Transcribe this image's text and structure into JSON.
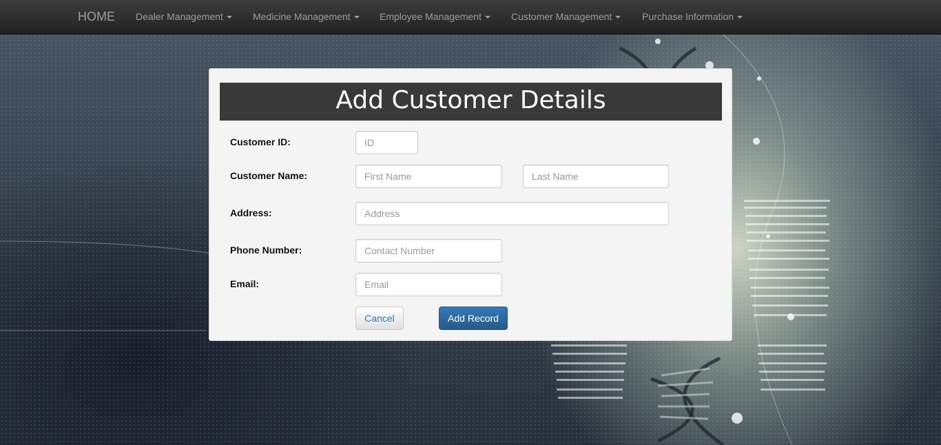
{
  "navbar": {
    "brand": "HOME",
    "items": [
      {
        "label": "Dealer Management"
      },
      {
        "label": "Medicine Management"
      },
      {
        "label": "Employee Management"
      },
      {
        "label": "Customer Management"
      },
      {
        "label": "Purchase Information"
      }
    ]
  },
  "form": {
    "title": "Add Customer Details",
    "customer_id": {
      "label": "Customer ID:",
      "placeholder": "ID",
      "value": ""
    },
    "customer_name": {
      "label": "Customer Name:",
      "first_placeholder": "First Name",
      "last_placeholder": "Last Name"
    },
    "address": {
      "label": "Address:",
      "placeholder": "Address"
    },
    "phone": {
      "label": "Phone Number:",
      "placeholder": "Contact Number"
    },
    "email": {
      "label": "Email:",
      "placeholder": "Email"
    },
    "cancel_label": "Cancel",
    "submit_label": "Add Record"
  },
  "colors": {
    "navbar": "#222222",
    "panel_header": "#393939",
    "primary_button": "#337ab7"
  }
}
